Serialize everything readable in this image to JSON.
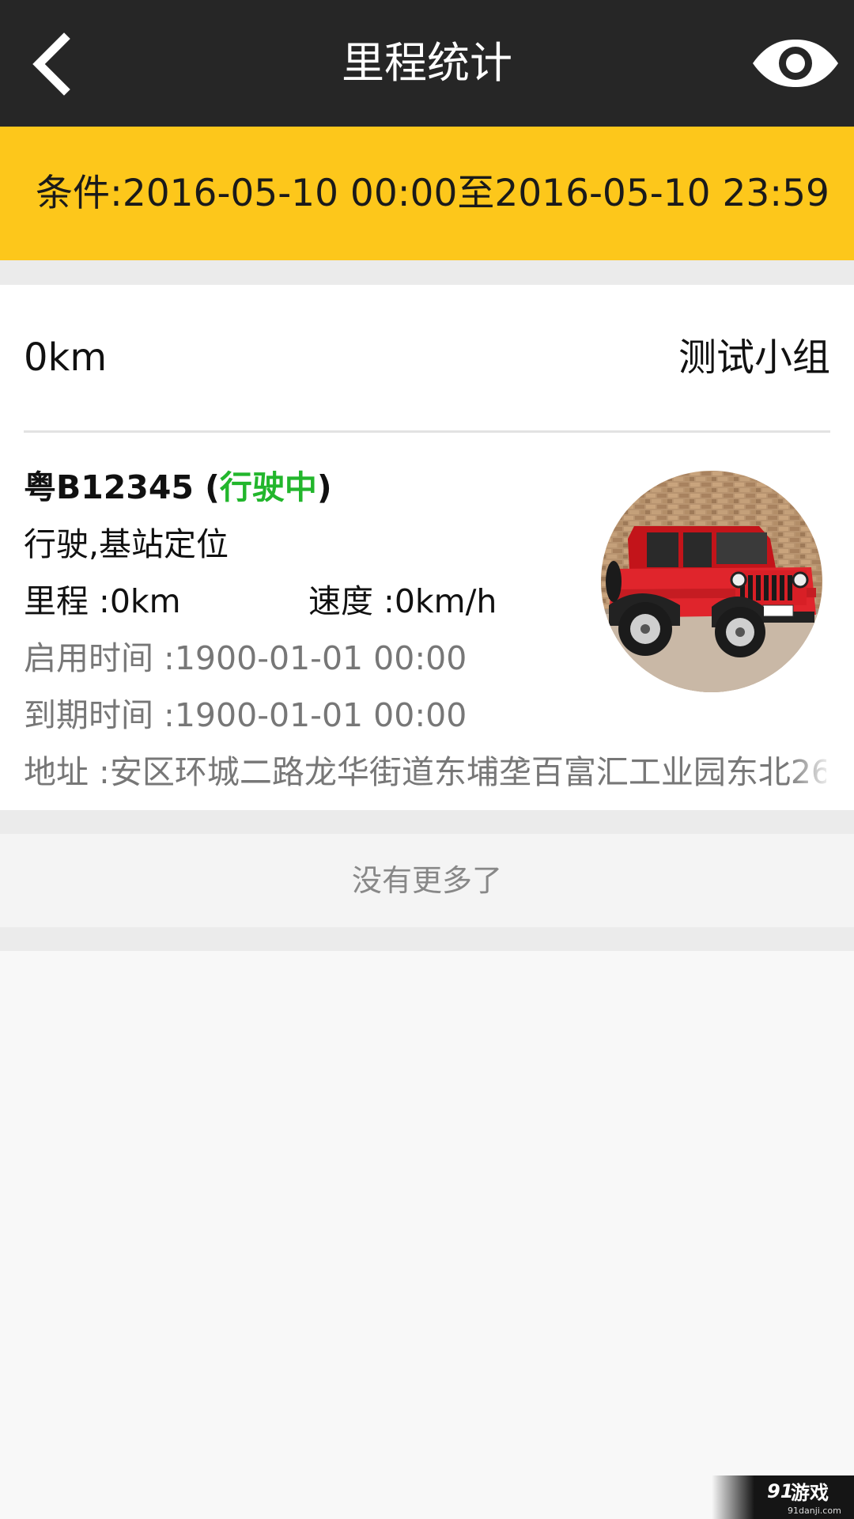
{
  "header": {
    "title": "里程统计",
    "back_icon": "chevron-left-icon",
    "eye_icon": "eye-icon"
  },
  "condition": {
    "text": "条件:2016-05-10 00:00至2016-05-10 23:59"
  },
  "summary": {
    "total_km": "0km",
    "group_name": "测试小组"
  },
  "vehicle": {
    "plate": "粤B12345",
    "status_open": " (",
    "status": "行驶中",
    "status_close": ")",
    "mode": "行驶,基站定位",
    "mileage": "里程 :0km",
    "speed": "速度 :0km/h",
    "start_time": "启用时间 :1900-01-01 00:00",
    "expire_time": "到期时间 :1900-01-01 00:00",
    "address": "地址 :安区环城二路龙华街道东埔垄百富汇工业园东北26"
  },
  "footer": {
    "no_more": "没有更多了"
  },
  "watermark": {
    "brand": "游戏",
    "site": "91danji.com"
  },
  "colors": {
    "header_bg": "#262626",
    "accent_yellow": "#fdc71b",
    "status_green": "#22b62c"
  }
}
